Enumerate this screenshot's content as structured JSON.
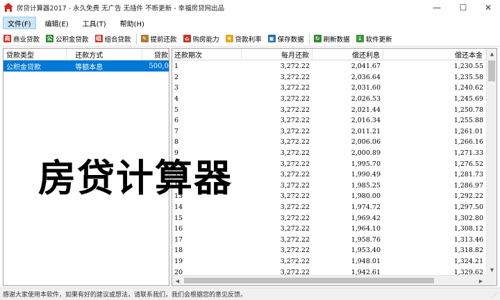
{
  "window": {
    "title": "房贷计算器2017 - 永久免费 无广告 无插件 不断更新 - 幸福房贷网出品",
    "controls": {
      "minimize": "—",
      "maximize": "☐",
      "close": "✕"
    }
  },
  "menu": {
    "items": [
      "文件(F)",
      "编辑(E)",
      "工具(T)",
      "帮助(H)"
    ],
    "active_index": 0
  },
  "toolbar": {
    "buttons": [
      {
        "label": "商业贷款",
        "icon": "commercial-loan-icon",
        "icon_char": "商",
        "color": "#d9261c"
      },
      {
        "label": "公积金贷款",
        "icon": "provident-fund-icon",
        "icon_char": "公",
        "color": "#2e8b2e"
      },
      {
        "label": "组合贷款",
        "icon": "combo-loan-icon",
        "icon_char": "组",
        "color": "#c0392b"
      },
      {
        "label": "提前还款",
        "icon": "prepayment-icon",
        "icon_char": "✎",
        "color": "#b07b2c"
      },
      {
        "label": "购房能力",
        "icon": "house-icon",
        "icon_char": "⌂",
        "color": "#c0392b"
      },
      {
        "label": "贷款利率",
        "icon": "star-icon",
        "icon_char": "★",
        "color": "#e6a817"
      },
      {
        "label": "保存数据",
        "icon": "save-icon",
        "icon_char": "▣",
        "color": "#1e6fb8"
      },
      {
        "label": "刷新数据",
        "icon": "refresh-icon",
        "icon_char": "↻",
        "color": "#2e8b2e"
      },
      {
        "label": "软件更新",
        "icon": "download-icon",
        "icon_char": "↓",
        "color": "#3a9a3a"
      }
    ]
  },
  "left_table": {
    "headers": [
      "贷款类型",
      "还款方式",
      "贷款"
    ],
    "rows": [
      {
        "type": "公积金贷款",
        "method": "等额本息",
        "amount": "500,0",
        "selected": true
      }
    ]
  },
  "schedule": {
    "headers": [
      "还款期次",
      "每月还款",
      "偿还利息",
      "偿还本金"
    ],
    "rows": [
      [
        "1",
        "3,272.22",
        "2,041.67",
        "1,230.55"
      ],
      [
        "2",
        "3,272.22",
        "2,036.64",
        "1,235.58"
      ],
      [
        "3",
        "3,272.22",
        "2,031.60",
        "1,240.62"
      ],
      [
        "4",
        "3,272.22",
        "2,026.53",
        "1,245.69"
      ],
      [
        "5",
        "3,272.22",
        "2,021.44",
        "1,250.78"
      ],
      [
        "6",
        "3,272.22",
        "2,016.34",
        "1,255.88"
      ],
      [
        "7",
        "3,272.22",
        "2,011.21",
        "1,261.01"
      ],
      [
        "8",
        "3,272.22",
        "2,006.06",
        "1,266.16"
      ],
      [
        "9",
        "3,272.22",
        "2,000.89",
        "1,271.33"
      ],
      [
        "10",
        "3,272.22",
        "1,995.70",
        "1,276.52"
      ],
      [
        "11",
        "3,272.22",
        "1,990.49",
        "1,281.73"
      ],
      [
        "12",
        "3,272.22",
        "1,985.25",
        "1,286.97"
      ],
      [
        "13",
        "3,272.22",
        "1,980.00",
        "1,292.22"
      ],
      [
        "14",
        "3,272.22",
        "1,974.72",
        "1,297.50"
      ],
      [
        "15",
        "3,272.22",
        "1,969.42",
        "1,302.80"
      ],
      [
        "16",
        "3,272.22",
        "1,964.10",
        "1,308.12"
      ],
      [
        "17",
        "3,272.22",
        "1,958.76",
        "1,313.46"
      ],
      [
        "18",
        "3,272.22",
        "1,953.40",
        "1,318.82"
      ],
      [
        "19",
        "3,272.22",
        "1,948.01",
        "1,324.21"
      ],
      [
        "20",
        "3,272.22",
        "1,942.61",
        "1,329.62"
      ]
    ]
  },
  "status": {
    "text": "感谢大家使用本软件，如果有好的建议或想法，请联系我们，我们会根据您的意见反馈。"
  },
  "overlay": {
    "caption": "房贷计算器"
  }
}
